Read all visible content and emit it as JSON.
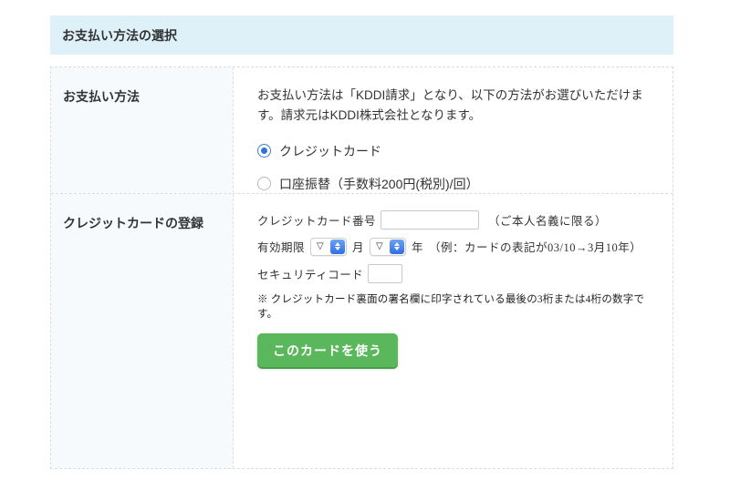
{
  "header": {
    "title": "お支払い方法の選択"
  },
  "payment_method": {
    "row_label": "お支払い方法",
    "description": "お支払い方法は「KDDI請求」となり、以下の方法がお選びいただけます。請求元はKDDI株式会社となります。",
    "options": [
      {
        "label": "クレジットカード",
        "selected": true
      },
      {
        "label": "口座振替（手数料200円(税別)/回）",
        "selected": false
      }
    ]
  },
  "card_registration": {
    "row_label": "クレジットカードの登録",
    "card_number": {
      "label": "クレジットカード番号",
      "value": "",
      "inline_note": "（ご本人名義に限る）"
    },
    "expiry": {
      "label": "有効期限",
      "month_value": "▽",
      "month_unit": "月",
      "year_value": "▽",
      "year_unit": "年",
      "example": "（例：カードの表記が03/10→3月10年）"
    },
    "security_code": {
      "label": "セキュリティコード",
      "value": ""
    },
    "note": "※ クレジットカード裏面の署名欄に印字されている最後の3桁または4桁の数字です。",
    "submit_label": "このカードを使う"
  },
  "colors": {
    "header_bg": "#def0f8",
    "left_cell_bg": "#f6fafd",
    "border": "#d9dde0",
    "radio_selected": "#2e74d6",
    "stepper_blue": "#2f6fe4",
    "button_green": "#5bb75b",
    "button_shadow_green": "#4a9d4a"
  }
}
